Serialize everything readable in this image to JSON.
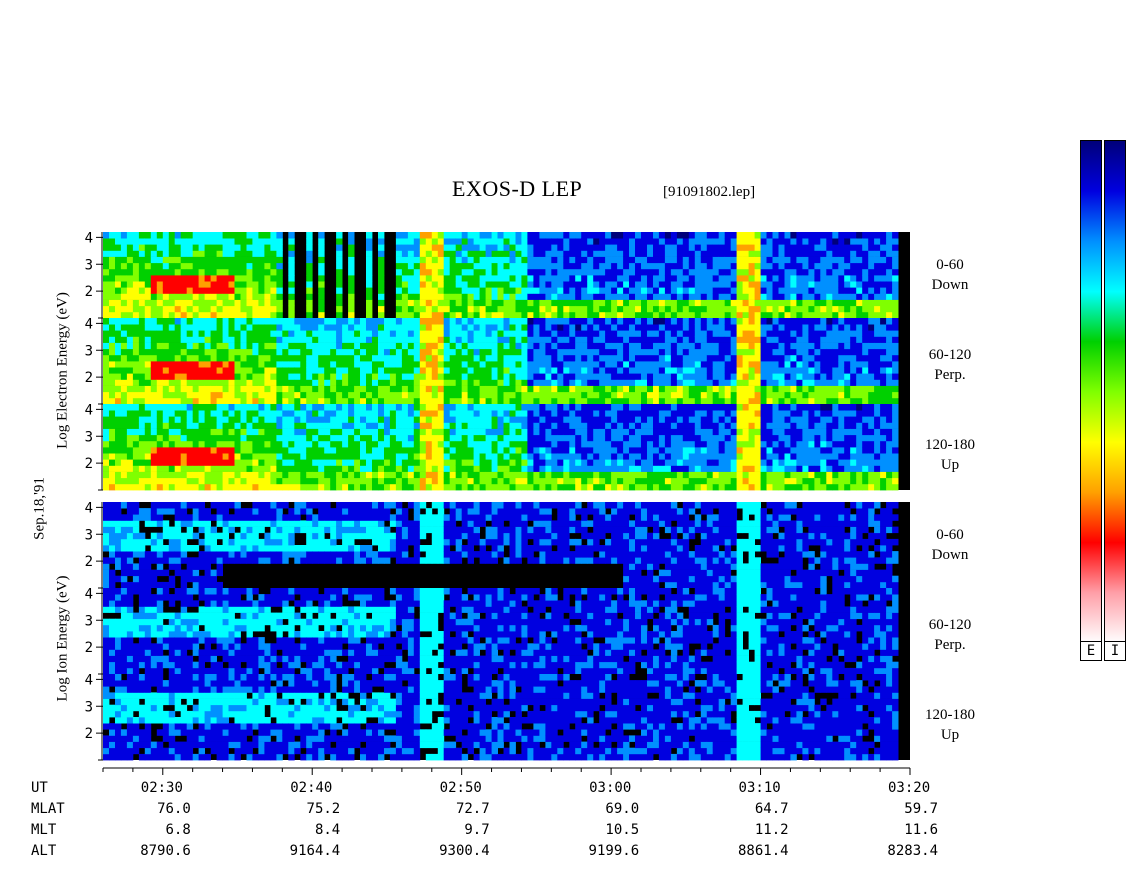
{
  "title": "EXOS-D LEP",
  "file_label": "[91091802.lep]",
  "date_label": "Sep.18,'91",
  "colors": {
    "scale": [
      "#ffffff",
      "#ff9fa8",
      "#ff0000",
      "#ffa000",
      "#ffff00",
      "#80ff00",
      "#00d000",
      "#00ffff",
      "#0090ff",
      "#0000e0",
      "#00007a"
    ]
  },
  "electron": {
    "axis_label": "Log Electron Energy (eV)",
    "panels": [
      {
        "name": "0-60",
        "sub": "Down"
      },
      {
        "name": "60-120",
        "sub": "Perp."
      },
      {
        "name": "120-180",
        "sub": "Up"
      }
    ]
  },
  "ion": {
    "axis_label": "Log Ion Energy (eV)",
    "panels": [
      {
        "name": "0-60",
        "sub": "Down"
      },
      {
        "name": "60-120",
        "sub": "Perp."
      },
      {
        "name": "120-180",
        "sub": "Up"
      }
    ]
  },
  "ytick_labels": [
    "4",
    "3",
    "2"
  ],
  "colorbar_labels": [
    "E",
    "I"
  ],
  "footer": {
    "labels": [
      "UT",
      "MLAT",
      "MLT",
      "ALT"
    ],
    "columns": [
      {
        "ut": "02:30",
        "mlat": "76.0",
        "mlt": "6.8",
        "alt": "8790.6"
      },
      {
        "ut": "02:40",
        "mlat": "75.2",
        "mlt": "8.4",
        "alt": "9164.4"
      },
      {
        "ut": "02:50",
        "mlat": "72.7",
        "mlt": "9.7",
        "alt": "9300.4"
      },
      {
        "ut": "03:00",
        "mlat": "69.0",
        "mlt": "10.5",
        "alt": "9199.6"
      },
      {
        "ut": "03:10",
        "mlat": "64.7",
        "mlt": "11.2",
        "alt": "8861.4"
      },
      {
        "ut": "03:20",
        "mlat": "59.7",
        "mlt": "11.6",
        "alt": "8283.4"
      }
    ]
  },
  "chart_data": {
    "type": "heatmap",
    "title": "EXOS-D LEP",
    "x_range_minutes_after_0230": [
      -4,
      50
    ],
    "xtick_minutes": [
      0,
      10,
      20,
      30,
      40,
      50
    ],
    "y_axis": "Log Energy (eV)",
    "ylim": [
      1,
      4.2
    ],
    "yticks": [
      2,
      3,
      4
    ],
    "scale": "log",
    "features": {
      "electron_mode_changes": [
        7.5,
        15.5,
        24.5
      ],
      "bright_band_times": [
        18.2,
        39.2
      ],
      "data_end": 49
    }
  }
}
